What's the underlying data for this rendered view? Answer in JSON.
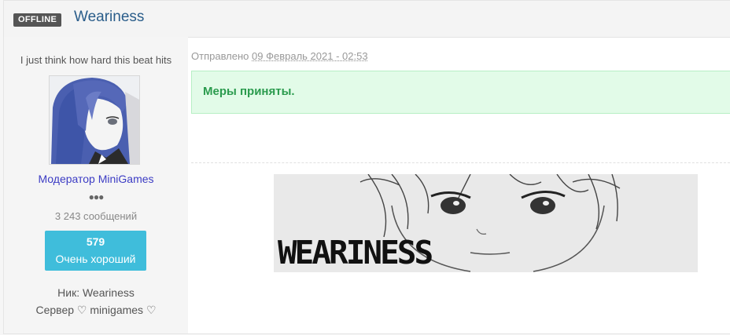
{
  "header": {
    "status_badge": "OFFLINE",
    "title": "Weariness"
  },
  "author": {
    "tagline": "I just think how hard this beat hits",
    "rank": "Модератор MiniGames",
    "pips": "●●●",
    "post_count": "3 243 сообщений",
    "reputation_value": "579",
    "reputation_label": "Очень хороший",
    "nick": "Ник: Weariness",
    "server": "Сервер ♡ minigames ♡"
  },
  "post": {
    "posted_prefix": "Отправлено",
    "posted_date": "09 Февраль 2021 - 02:53",
    "notice": "Меры приняты."
  },
  "signature": {
    "banner_text": "WEARINESS"
  },
  "colors": {
    "title": "#2a5d8a",
    "rank": "#3c3cc4",
    "reputation_bg": "#3fbddb",
    "notice_bg": "#e2fbe8",
    "notice_text": "#2b9b4e"
  }
}
